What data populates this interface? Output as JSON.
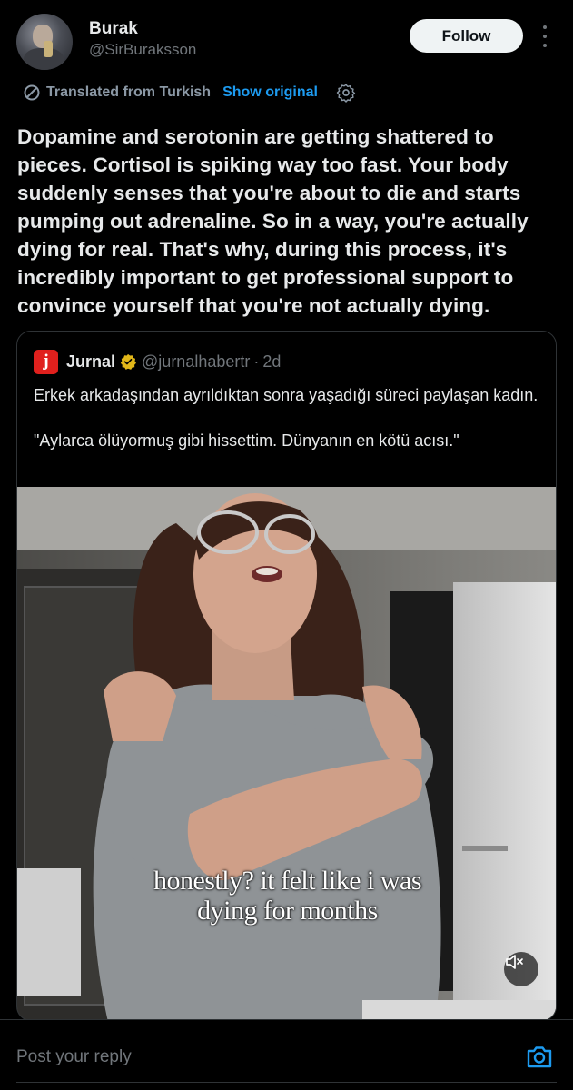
{
  "author": {
    "name": "Burak",
    "handle": "@SirBuraksson",
    "avatar": "user-avatar"
  },
  "header": {
    "follow_label": "Follow",
    "more_icon": "more-vertical-icon"
  },
  "translation": {
    "label": "Translated from Turkish",
    "show_original": "Show original",
    "icon": "translate-icon",
    "settings_icon": "gear-icon"
  },
  "post": {
    "text": "Dopamine and serotonin are getting shattered to pieces. Cortisol is spiking way too fast. Your body suddenly senses that you're about to die and starts pumping out adrenaline. So in a way, you're actually dying for real. That's why, during this process, it's incredibly important to get professional support to convince yourself that you're not actually dying."
  },
  "quote": {
    "avatar_letter": "j",
    "name": "Jurnal",
    "handle": "@jurnalhabertr",
    "separator": "·",
    "time": "2d",
    "verified_icon": "verified-gold-badge-icon",
    "text_line1": "Erkek arkadaşından ayrıldıktan sonra yaşadığı süreci paylaşan kadın.",
    "text_line2": "\"Aylarca ölüyormuş gibi hissettim. Dünyanın en kötü acısı.\"",
    "video": {
      "caption_line1": "honestly? it felt like i was",
      "caption_line2": "dying for months",
      "mute_icon": "speaker-muted-icon"
    }
  },
  "reply": {
    "placeholder": "Post your reply",
    "camera_icon": "camera-icon"
  },
  "colors": {
    "background": "#000000",
    "text": "#e7e9ea",
    "secondary": "#71767b",
    "accent": "#1d9bf0",
    "border": "#2f3336",
    "verified": "#e2b719"
  }
}
